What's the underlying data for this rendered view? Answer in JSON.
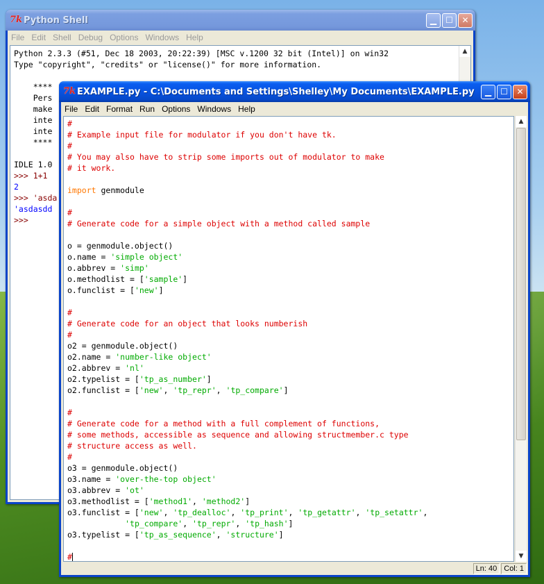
{
  "shell": {
    "title": "Python Shell",
    "menu": [
      "File",
      "Edit",
      "Shell",
      "Debug",
      "Options",
      "Windows",
      "Help"
    ],
    "lines": [
      {
        "t": "Python 2.3.3 (#51, Dec 18 2003, 20:22:39) [MSC v.1200 32 bit (Intel)] on win32",
        "c": ""
      },
      {
        "t": "Type \"copyright\", \"credits\" or \"license()\" for more information.",
        "c": ""
      },
      {
        "t": "",
        "c": ""
      },
      {
        "t": "    ****",
        "c": ""
      },
      {
        "t": "    Pers",
        "c": ""
      },
      {
        "t": "    make",
        "c": ""
      },
      {
        "t": "    inte",
        "c": ""
      },
      {
        "t": "    inte",
        "c": ""
      },
      {
        "t": "    ****",
        "c": ""
      },
      {
        "t": "",
        "c": ""
      },
      {
        "t": "IDLE 1.0",
        "c": ""
      },
      {
        "t": ">>> 1+1",
        "c": "prompt"
      },
      {
        "t": "2",
        "c": "out"
      },
      {
        "t": ">>> 'asda",
        "c": "prompt"
      },
      {
        "t": "'asdasdd",
        "c": "out"
      },
      {
        "t": ">>>",
        "c": "prompt"
      }
    ]
  },
  "editor": {
    "title": "EXAMPLE.py - C:\\Documents and Settings\\Shelley\\My Documents\\EXAMPLE.py",
    "menu": [
      "File",
      "Edit",
      "Format",
      "Run",
      "Options",
      "Windows",
      "Help"
    ],
    "status_line": "Ln: 40",
    "status_col": "Col: 1",
    "code": [
      [
        [
          "#",
          "comment"
        ]
      ],
      [
        [
          "# Example input file for modulator if you don't have tk.",
          "comment"
        ]
      ],
      [
        [
          "#",
          "comment"
        ]
      ],
      [
        [
          "# You may also have to strip some imports out of modulator to make",
          "comment"
        ]
      ],
      [
        [
          "# it work.",
          "comment"
        ]
      ],
      [],
      [
        [
          "import",
          "kw"
        ],
        [
          " genmodule",
          ""
        ]
      ],
      [],
      [
        [
          "#",
          "comment"
        ]
      ],
      [
        [
          "# Generate code for a simple object with a method called sample",
          "comment"
        ]
      ],
      [],
      [
        [
          "o = genmodule.object()",
          ""
        ]
      ],
      [
        [
          "o.name = ",
          ""
        ],
        [
          "'simple object'",
          "str"
        ]
      ],
      [
        [
          "o.abbrev = ",
          ""
        ],
        [
          "'simp'",
          "str"
        ]
      ],
      [
        [
          "o.methodlist = [",
          ""
        ],
        [
          "'sample'",
          "str"
        ],
        [
          "]",
          ""
        ]
      ],
      [
        [
          "o.funclist = [",
          ""
        ],
        [
          "'new'",
          "str"
        ],
        [
          "]",
          ""
        ]
      ],
      [],
      [
        [
          "#",
          "comment"
        ]
      ],
      [
        [
          "# Generate code for an object that looks numberish",
          "comment"
        ]
      ],
      [
        [
          "#",
          "comment"
        ]
      ],
      [
        [
          "o2 = genmodule.object()",
          ""
        ]
      ],
      [
        [
          "o2.name = ",
          ""
        ],
        [
          "'number-like object'",
          "str"
        ]
      ],
      [
        [
          "o2.abbrev = ",
          ""
        ],
        [
          "'nl'",
          "str"
        ]
      ],
      [
        [
          "o2.typelist = [",
          ""
        ],
        [
          "'tp_as_number'",
          "str"
        ],
        [
          "]",
          ""
        ]
      ],
      [
        [
          "o2.funclist = [",
          ""
        ],
        [
          "'new'",
          "str"
        ],
        [
          ", ",
          ""
        ],
        [
          "'tp_repr'",
          "str"
        ],
        [
          ", ",
          ""
        ],
        [
          "'tp_compare'",
          "str"
        ],
        [
          "]",
          ""
        ]
      ],
      [],
      [
        [
          "#",
          "comment"
        ]
      ],
      [
        [
          "# Generate code for a method with a full complement of functions,",
          "comment"
        ]
      ],
      [
        [
          "# some methods, accessible as sequence and allowing structmember.c type",
          "comment"
        ]
      ],
      [
        [
          "# structure access as well.",
          "comment"
        ]
      ],
      [
        [
          "#",
          "comment"
        ]
      ],
      [
        [
          "o3 = genmodule.object()",
          ""
        ]
      ],
      [
        [
          "o3.name = ",
          ""
        ],
        [
          "'over-the-top object'",
          "str"
        ]
      ],
      [
        [
          "o3.abbrev = ",
          ""
        ],
        [
          "'ot'",
          "str"
        ]
      ],
      [
        [
          "o3.methodlist = [",
          ""
        ],
        [
          "'method1'",
          "str"
        ],
        [
          ", ",
          ""
        ],
        [
          "'method2'",
          "str"
        ],
        [
          "]",
          ""
        ]
      ],
      [
        [
          "o3.funclist = [",
          ""
        ],
        [
          "'new'",
          "str"
        ],
        [
          ", ",
          ""
        ],
        [
          "'tp_dealloc'",
          "str"
        ],
        [
          ", ",
          ""
        ],
        [
          "'tp_print'",
          "str"
        ],
        [
          ", ",
          ""
        ],
        [
          "'tp_getattr'",
          "str"
        ],
        [
          ", ",
          ""
        ],
        [
          "'tp_setattr'",
          "str"
        ],
        [
          ",",
          ""
        ]
      ],
      [
        [
          "            ",
          ""
        ],
        [
          "'tp_compare'",
          "str"
        ],
        [
          ", ",
          ""
        ],
        [
          "'tp_repr'",
          "str"
        ],
        [
          ", ",
          ""
        ],
        [
          "'tp_hash'",
          "str"
        ],
        [
          "]",
          ""
        ]
      ],
      [
        [
          "o3.typelist = [",
          ""
        ],
        [
          "'tp_as_sequence'",
          "str"
        ],
        [
          ", ",
          ""
        ],
        [
          "'structure'",
          "str"
        ],
        [
          "]",
          ""
        ]
      ],
      [],
      [
        [
          "#",
          "comment"
        ]
      ]
    ]
  }
}
